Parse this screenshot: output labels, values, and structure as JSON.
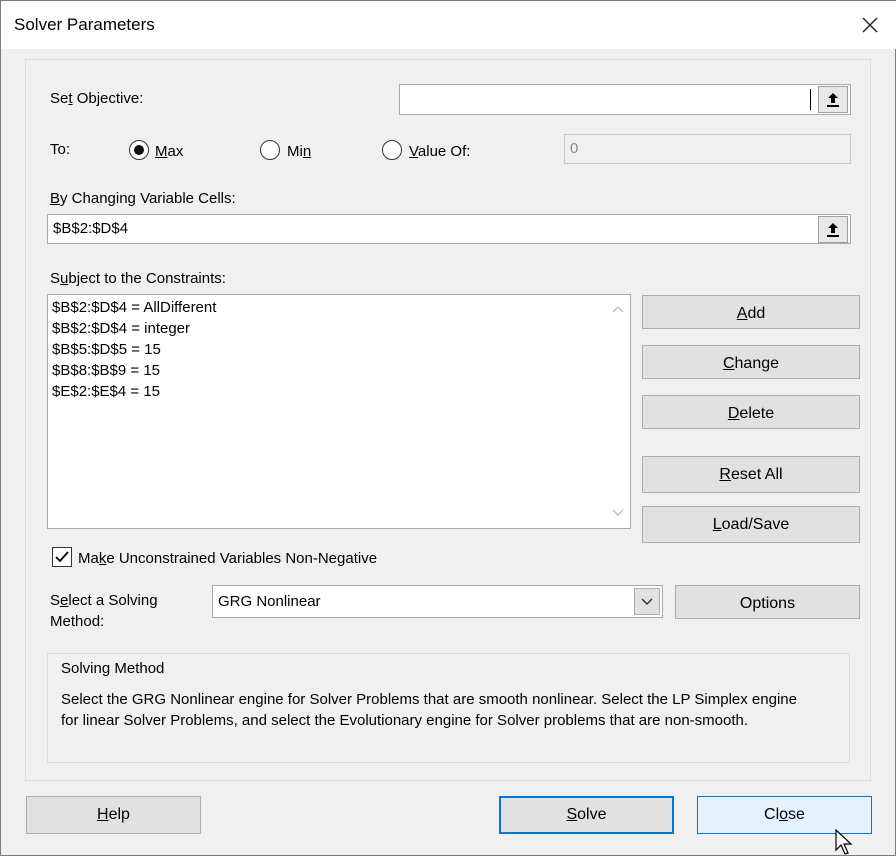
{
  "window": {
    "title": "Solver Parameters"
  },
  "objective": {
    "label_pre": "Se",
    "label_u": "t",
    "label_post": " Objective:",
    "value": ""
  },
  "to": {
    "label": "To:",
    "max": {
      "u": "M",
      "rest": "ax",
      "selected": true
    },
    "min": {
      "pre": "Mi",
      "u": "n",
      "selected": false
    },
    "value_of": {
      "u": "V",
      "rest": "alue Of:",
      "selected": false,
      "value": "0"
    }
  },
  "variables": {
    "label_u": "B",
    "label_rest": "y Changing Variable Cells:",
    "value": "$B$2:$D$4"
  },
  "constraints": {
    "label_pre": "S",
    "label_u": "u",
    "label_post": "bject to the Constraints:",
    "items": [
      "$B$2:$D$4 = AllDifferent",
      "$B$2:$D$4 = integer",
      "$B$5:$D$5 = 15",
      "$B$8:$B$9 = 15",
      "$E$2:$E$4 = 15"
    ]
  },
  "buttons": {
    "add": {
      "u": "A",
      "rest": "dd"
    },
    "change": {
      "u": "C",
      "rest": "hange"
    },
    "delete": {
      "u": "D",
      "rest": "elete"
    },
    "reset_all": {
      "u": "R",
      "rest": "eset All"
    },
    "load_save": {
      "u": "L",
      "rest": "oad/Save"
    },
    "options": {
      "label": "Options"
    },
    "help": {
      "u": "H",
      "rest": "elp"
    },
    "solve": {
      "u": "S",
      "rest": "olve"
    },
    "close": {
      "pre": "Cl",
      "u": "o",
      "post": "se"
    }
  },
  "nonneg": {
    "pre": "Ma",
    "u": "k",
    "post": "e Unconstrained Variables Non-Negative",
    "checked": true
  },
  "method": {
    "label_pre": "S",
    "label_u": "e",
    "label_rest": "lect a Solving",
    "label_line2": "Method:",
    "value": "GRG Nonlinear"
  },
  "solving_method": {
    "title": "Solving Method",
    "line1": "Select the GRG Nonlinear engine for Solver Problems that are smooth nonlinear. Select the LP Simplex engine",
    "line2": "for linear Solver Problems, and select the Evolutionary engine for Solver problems that are non-smooth."
  },
  "icons": [
    "close-icon",
    "collapse-dialog-icon",
    "radio-icon",
    "checkbox-check-icon",
    "chevron-down-icon",
    "scroll-up-icon",
    "scroll-down-icon",
    "mouse-cursor-icon"
  ],
  "colors": {
    "accent": "#0078d7",
    "dialog_bg": "#f0f0f0",
    "button_bg": "#e1e1e1"
  }
}
